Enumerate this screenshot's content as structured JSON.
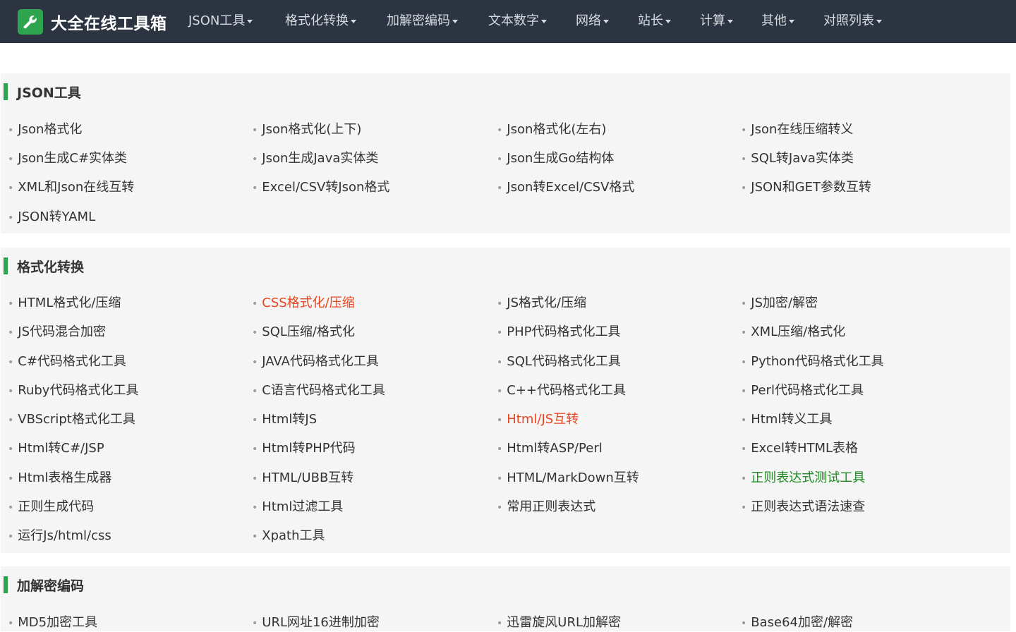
{
  "brand": {
    "title": "大全在线工具箱",
    "icon": "wrench-icon"
  },
  "nav": [
    {
      "label": "JSON工具"
    },
    {
      "label": "格式化转换"
    },
    {
      "label": "加解密编码"
    },
    {
      "label": "文本数字"
    },
    {
      "label": "网络"
    },
    {
      "label": "站长"
    },
    {
      "label": "计算"
    },
    {
      "label": "其他"
    },
    {
      "label": "对照列表"
    }
  ],
  "colors": {
    "accent": "#2ea44f",
    "nav_bg": "#2b3440",
    "highlight_red": "#e8451e",
    "highlight_green": "#1f8a24"
  },
  "sections": [
    {
      "title": "JSON工具",
      "items": [
        {
          "label": "Json格式化"
        },
        {
          "label": "Json格式化(上下)"
        },
        {
          "label": "Json格式化(左右)"
        },
        {
          "label": "Json在线压缩转义"
        },
        {
          "label": "Json生成C#实体类"
        },
        {
          "label": "Json生成Java实体类"
        },
        {
          "label": "Json生成Go结构体"
        },
        {
          "label": "SQL转Java实体类"
        },
        {
          "label": "XML和Json在线互转"
        },
        {
          "label": "Excel/CSV转Json格式"
        },
        {
          "label": "Json转Excel/CSV格式"
        },
        {
          "label": "JSON和GET参数互转"
        },
        {
          "label": "JSON转YAML"
        }
      ]
    },
    {
      "title": "格式化转换",
      "items": [
        {
          "label": "HTML格式化/压缩"
        },
        {
          "label": "CSS格式化/压缩",
          "style": "red"
        },
        {
          "label": "JS格式化/压缩"
        },
        {
          "label": "JS加密/解密"
        },
        {
          "label": "JS代码混合加密"
        },
        {
          "label": "SQL压缩/格式化"
        },
        {
          "label": "PHP代码格式化工具"
        },
        {
          "label": "XML压缩/格式化"
        },
        {
          "label": "C#代码格式化工具"
        },
        {
          "label": "JAVA代码格式化工具"
        },
        {
          "label": "SQL代码格式化工具"
        },
        {
          "label": "Python代码格式化工具"
        },
        {
          "label": "Ruby代码格式化工具"
        },
        {
          "label": "C语言代码格式化工具"
        },
        {
          "label": "C++代码格式化工具"
        },
        {
          "label": "Perl代码格式化工具"
        },
        {
          "label": "VBScript格式化工具"
        },
        {
          "label": "Html转JS"
        },
        {
          "label": "Html/JS互转",
          "style": "red"
        },
        {
          "label": "Html转义工具"
        },
        {
          "label": "Html转C#/JSP"
        },
        {
          "label": "Html转PHP代码"
        },
        {
          "label": "Html转ASP/Perl"
        },
        {
          "label": "Excel转HTML表格"
        },
        {
          "label": "Html表格生成器"
        },
        {
          "label": "HTML/UBB互转"
        },
        {
          "label": "HTML/MarkDown互转"
        },
        {
          "label": "正则表达式测试工具",
          "style": "green"
        },
        {
          "label": "正则生成代码"
        },
        {
          "label": "Html过滤工具"
        },
        {
          "label": "常用正则表达式"
        },
        {
          "label": "正则表达式语法速查"
        },
        {
          "label": "运行Js/html/css"
        },
        {
          "label": "Xpath工具"
        }
      ]
    },
    {
      "title": "加解密编码",
      "items": [
        {
          "label": "MD5加密工具"
        },
        {
          "label": "URL网址16进制加密"
        },
        {
          "label": "迅雷旋风URL加解密"
        },
        {
          "label": "Base64加密/解密"
        }
      ]
    }
  ]
}
